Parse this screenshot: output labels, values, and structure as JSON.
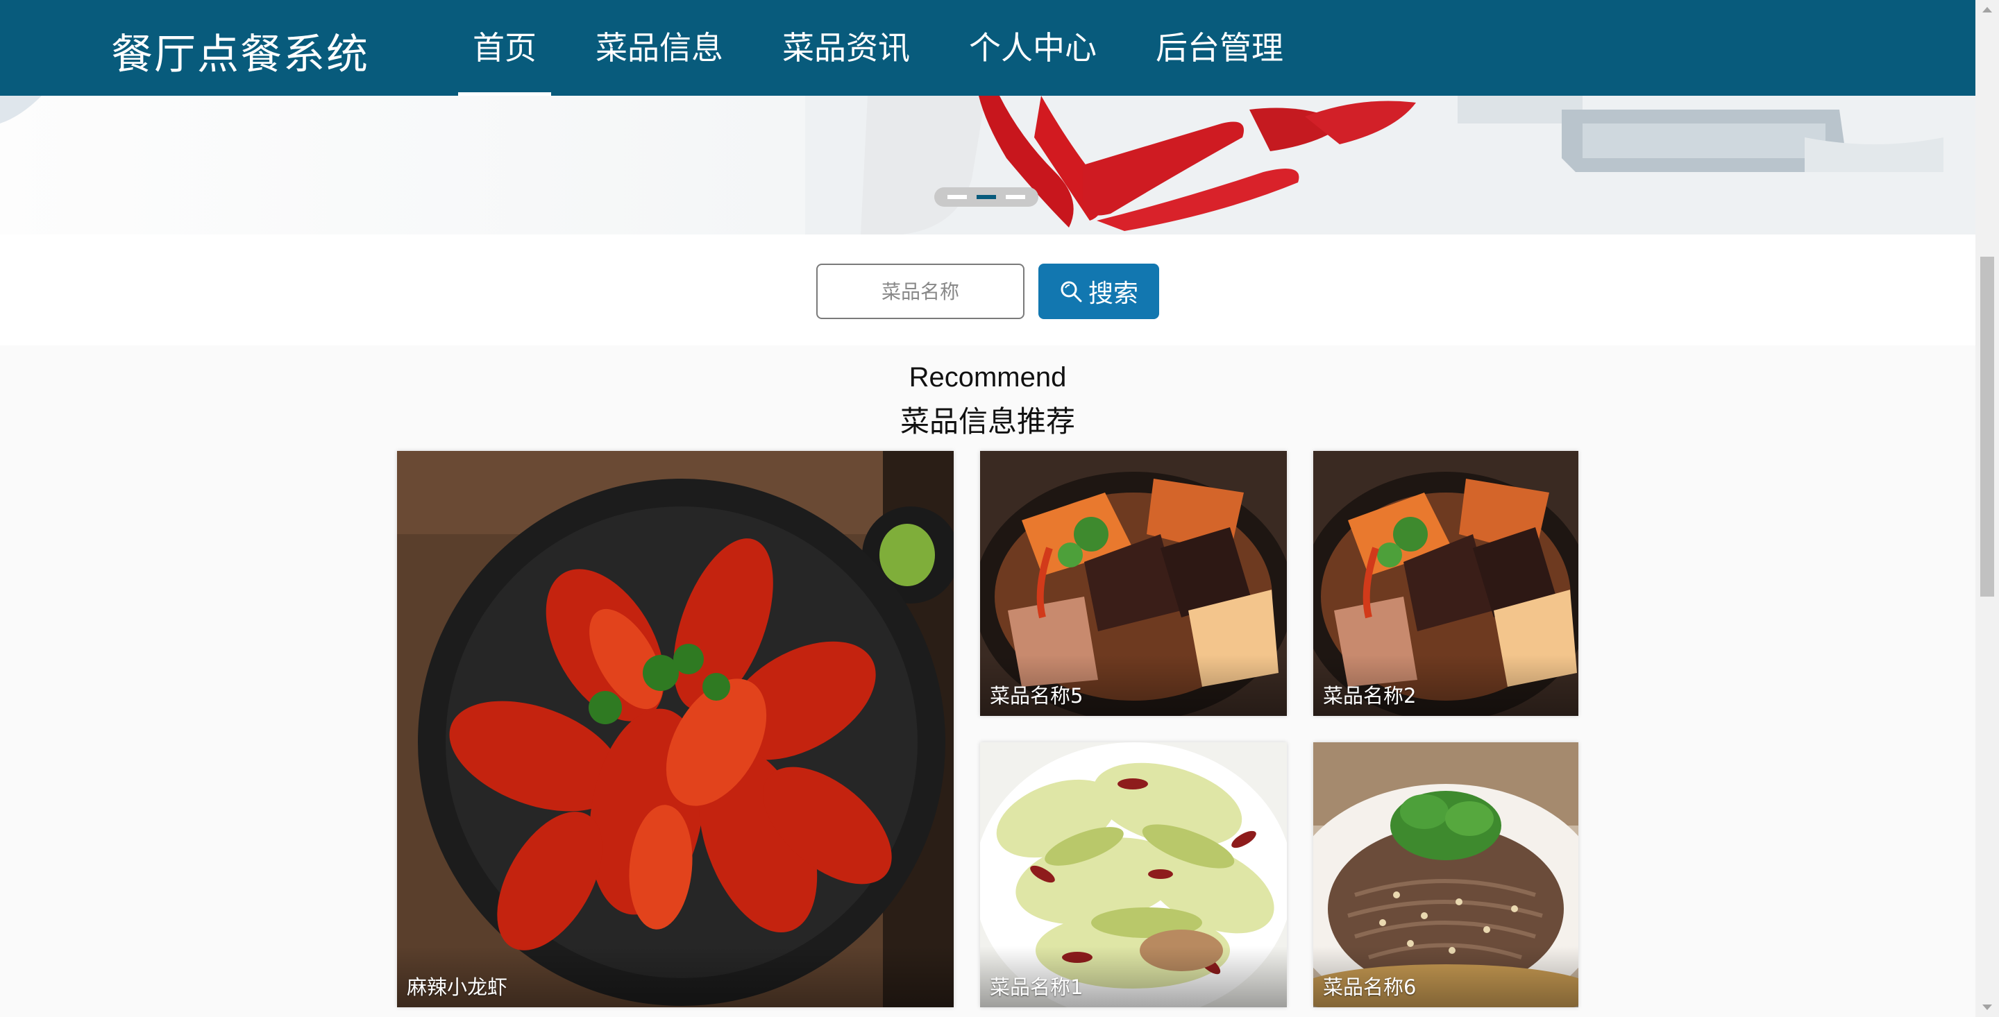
{
  "header": {
    "brand": "餐厅点餐系统",
    "nav": [
      {
        "label": "首页",
        "active": true
      },
      {
        "label": "菜品信息",
        "active": false
      },
      {
        "label": "菜品资讯",
        "active": false
      },
      {
        "label": "个人中心",
        "active": false
      },
      {
        "label": "后台管理",
        "active": false
      }
    ],
    "color": "#085b7c"
  },
  "banner": {
    "dots": 3,
    "active_dot": 2
  },
  "search": {
    "placeholder": "菜品名称",
    "value": "",
    "button_label": "搜索",
    "button_icon": "search-icon",
    "button_color": "#1277b0"
  },
  "recommend": {
    "title_en": "Recommend",
    "title_cn": "菜品信息推荐",
    "items": [
      {
        "name": "麻辣小龙虾",
        "image": "crayfish-photo"
      },
      {
        "name": "菜品名称5",
        "image": "braised-pork-photo"
      },
      {
        "name": "菜品名称2",
        "image": "braised-pork-photo"
      },
      {
        "name": "菜品名称1",
        "image": "stir-fried-cabbage-photo"
      },
      {
        "name": "菜品名称6",
        "image": "sliced-beef-photo"
      }
    ]
  }
}
